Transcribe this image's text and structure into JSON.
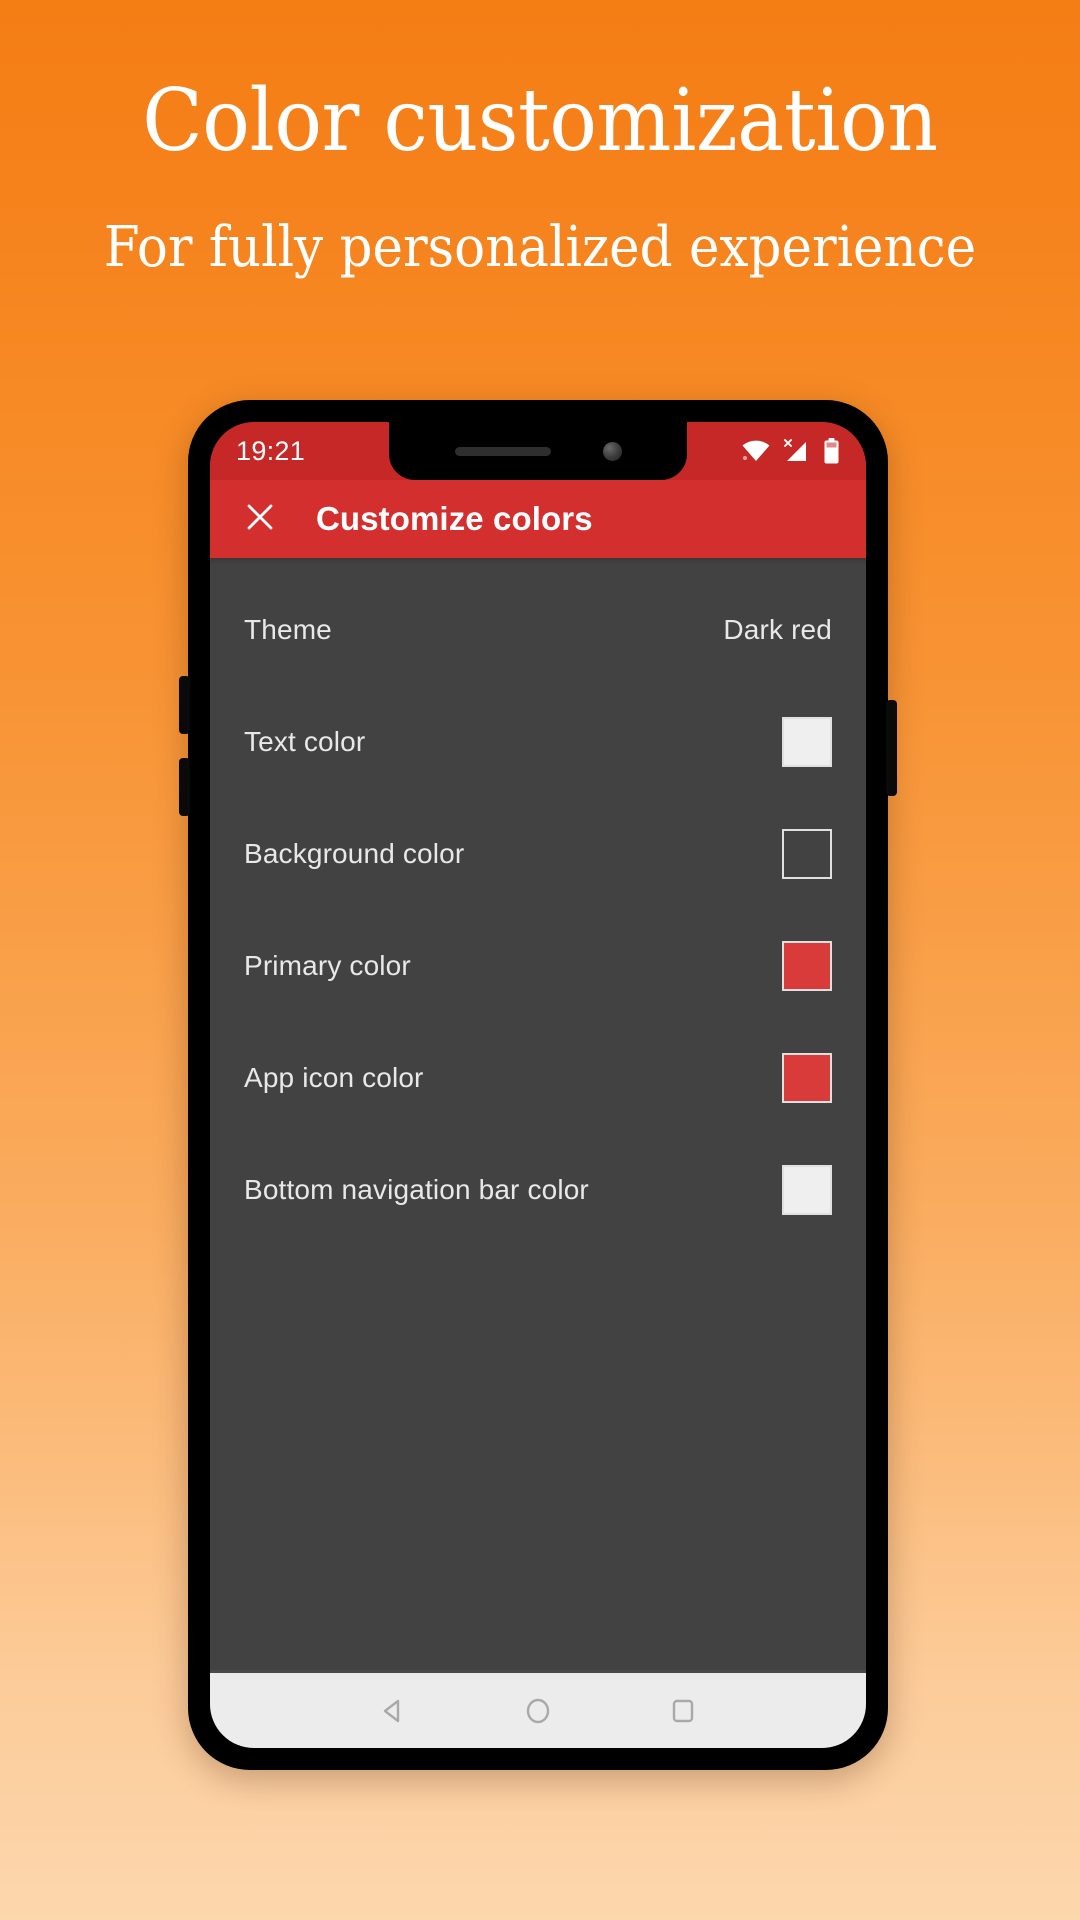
{
  "promo": {
    "title": "Color customization",
    "subtitle": "For fully personalized experience",
    "background_top": "#F47E14",
    "background_bottom": "#FDD7AD"
  },
  "phone": {
    "status_bar": {
      "time": "19:21",
      "background": "#C62828",
      "icons": [
        "wifi-icon",
        "cellular-signal-off-icon",
        "battery-icon"
      ]
    },
    "app_bar": {
      "close_icon": "close-icon",
      "title": "Customize colors",
      "background": "#D32F2F"
    },
    "content_background": "#424242",
    "settings": {
      "theme_row": {
        "label": "Theme",
        "value": "Dark red"
      },
      "color_rows": [
        {
          "label": "Text color",
          "swatch": "#EFEFEF",
          "border": "#E0E0E0"
        },
        {
          "label": "Background color",
          "swatch": "#424242",
          "border": "#E0E0E0"
        },
        {
          "label": "Primary color",
          "swatch": "#D93A3A",
          "border": "#E0E0E0"
        },
        {
          "label": "App icon color",
          "swatch": "#D93A3A",
          "border": "#E0E0E0"
        },
        {
          "label": "Bottom navigation bar color",
          "swatch": "#EFEFEF",
          "border": "#E0E0E0"
        }
      ]
    },
    "nav_bar": {
      "background": "#ECECEC",
      "buttons": [
        "back-icon",
        "home-icon",
        "recents-icon"
      ]
    }
  }
}
